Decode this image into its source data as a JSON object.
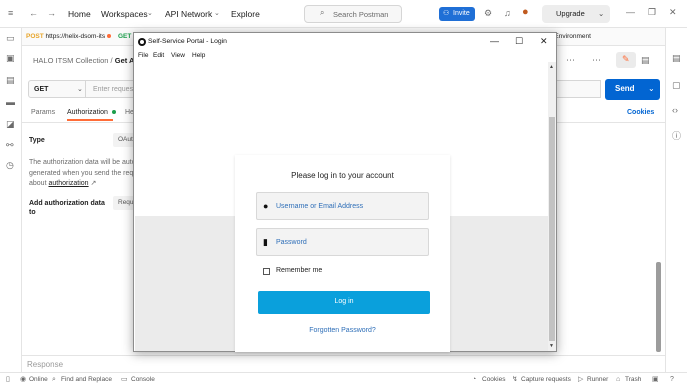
{
  "topbar": {
    "home": "Home",
    "workspaces": "Workspaces",
    "api_network": "API Network",
    "explore": "Explore",
    "search_placeholder": "Search Postman",
    "invite": "Invite",
    "upgrade": "Upgrade"
  },
  "tabs": {
    "tab1_method": "POST",
    "tab1_label": "https://helix-dsom-its",
    "tab2_method": "GET",
    "env": "o Environment"
  },
  "request": {
    "collection": "HALO ITSM Collection",
    "separator": "/",
    "request_name": "Get Acc",
    "method": "GET",
    "url_placeholder": "Enter reques",
    "send": "Send",
    "tabs": [
      "Params",
      "Authorization",
      "He"
    ],
    "cookies": "Cookies",
    "type_label": "Type",
    "type_value": "OAutl",
    "auth_text_1": "The authorization data will be auto",
    "auth_text_2": "generated when you send the requ",
    "auth_text_3": "about",
    "auth_link": "authorization",
    "add_auth_line1": "Add authorization data",
    "add_auth_line2": "to",
    "add_auth_value": "Requ",
    "response": "Response"
  },
  "statusbar": {
    "online": "Online",
    "find_replace": "Find and Replace",
    "console": "Console",
    "cookies": "Cookies",
    "capture": "Capture requests",
    "runner": "Runner",
    "trash": "Trash"
  },
  "window": {
    "title": "Self-Service Portal - Login",
    "menu": [
      "File",
      "Edit",
      "View",
      "Help"
    ]
  },
  "login": {
    "heading": "Please log in to your account",
    "username_placeholder": "Username or Email Address",
    "password_placeholder": "Password",
    "remember": "Remember me",
    "login_button": "Log in",
    "forgot": "Forgotten Password?"
  },
  "colors": {
    "accent": "#ff6c37",
    "send_blue": "#0265d2",
    "login_blue": "#0aa0dc",
    "link_blue": "#2f6fb8"
  }
}
